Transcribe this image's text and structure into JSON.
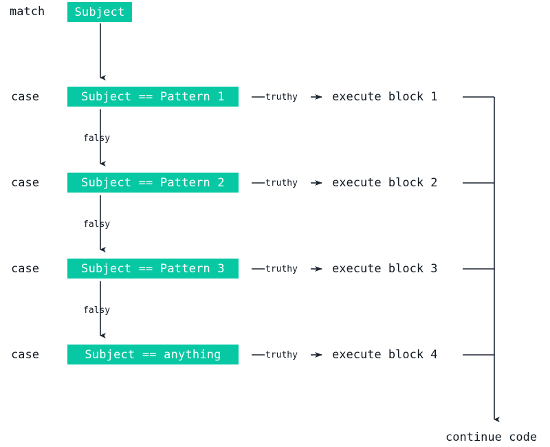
{
  "diagram": {
    "title": "match-case control flow",
    "colors": {
      "node_fill": "#08c8a4",
      "node_text": "#ffffff",
      "line": "#1b2430",
      "label_text": "#111922",
      "background": "#ffffff"
    },
    "keywords": {
      "match": "match",
      "case": "case"
    },
    "subject_node": "Subject",
    "rows": [
      {
        "keyword": "case",
        "condition": "Subject == Pattern 1",
        "truthy_label": "truthy",
        "action": "execute block 1",
        "falsy_label": "falsy"
      },
      {
        "keyword": "case",
        "condition": "Subject == Pattern 2",
        "truthy_label": "truthy",
        "action": "execute block 2",
        "falsy_label": "falsy"
      },
      {
        "keyword": "case",
        "condition": "Subject == Pattern 3",
        "truthy_label": "truthy",
        "action": "execute block 3",
        "falsy_label": "falsy"
      },
      {
        "keyword": "case",
        "condition": "Subject == anything",
        "truthy_label": "truthy",
        "action": "execute block 4",
        "falsy_label": null
      }
    ],
    "exit_node": "continue code"
  }
}
